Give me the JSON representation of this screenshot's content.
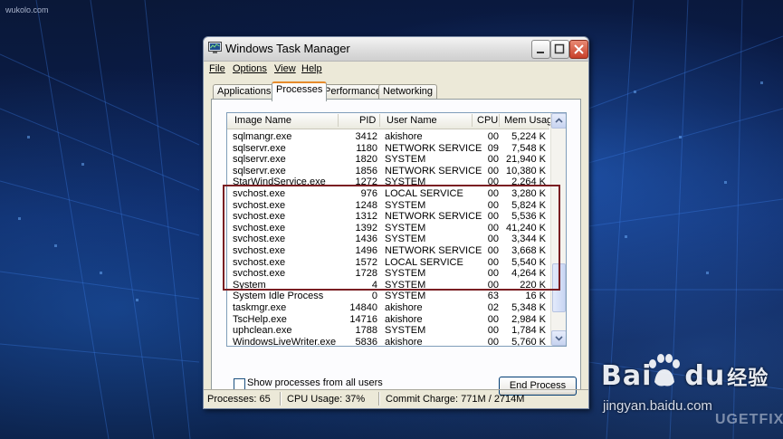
{
  "window": {
    "title": "Windows Task Manager",
    "controls": {
      "minimize": "_",
      "maximize": "□",
      "close": "×"
    }
  },
  "menu": [
    "File",
    "Options",
    "View",
    "Help"
  ],
  "tabs": [
    {
      "label": "Applications"
    },
    {
      "label": "Processes",
      "active": true
    },
    {
      "label": "Performance"
    },
    {
      "label": "Networking"
    }
  ],
  "columns": [
    "Image Name",
    "PID",
    "User Name",
    "CPU",
    "Mem Usage"
  ],
  "rows": [
    [
      "sqlmangr.exe",
      "3412",
      "akishore",
      "00",
      "5,224 K"
    ],
    [
      "sqlservr.exe",
      "1180",
      "NETWORK SERVICE",
      "09",
      "7,548 K"
    ],
    [
      "sqlservr.exe",
      "1820",
      "SYSTEM",
      "00",
      "21,940 K"
    ],
    [
      "sqlservr.exe",
      "1856",
      "NETWORK SERVICE",
      "00",
      "10,380 K"
    ],
    [
      "StarWindService.exe",
      "1272",
      "SYSTEM",
      "00",
      "2,264 K"
    ],
    [
      "svchost.exe",
      "976",
      "LOCAL SERVICE",
      "00",
      "3,280 K"
    ],
    [
      "svchost.exe",
      "1248",
      "SYSTEM",
      "00",
      "5,824 K"
    ],
    [
      "svchost.exe",
      "1312",
      "NETWORK SERVICE",
      "00",
      "5,536 K"
    ],
    [
      "svchost.exe",
      "1392",
      "SYSTEM",
      "00",
      "41,240 K"
    ],
    [
      "svchost.exe",
      "1436",
      "SYSTEM",
      "00",
      "3,344 K"
    ],
    [
      "svchost.exe",
      "1496",
      "NETWORK SERVICE",
      "00",
      "3,668 K"
    ],
    [
      "svchost.exe",
      "1572",
      "LOCAL SERVICE",
      "00",
      "5,540 K"
    ],
    [
      "svchost.exe",
      "1728",
      "SYSTEM",
      "00",
      "4,264 K"
    ],
    [
      "System",
      "4",
      "SYSTEM",
      "00",
      "220 K"
    ],
    [
      "System Idle Process",
      "0",
      "SYSTEM",
      "63",
      "16 K"
    ],
    [
      "taskmgr.exe",
      "14840",
      "akishore",
      "02",
      "5,348 K"
    ],
    [
      "TscHelp.exe",
      "14716",
      "akishore",
      "00",
      "2,984 K"
    ],
    [
      "uphclean.exe",
      "1788",
      "SYSTEM",
      "00",
      "1,784 K"
    ],
    [
      "WindowsLiveWriter.exe",
      "5836",
      "akishore",
      "00",
      "5,760 K"
    ]
  ],
  "checkbox_label": "Show processes from all users",
  "end_process_label": "End Process",
  "status": {
    "processes": "Processes: 65",
    "cpu": "CPU Usage: 37%",
    "commit": "Commit Charge: 771M / 2714M"
  },
  "desktop": {
    "corner_text": "wukolo.com",
    "watermark_logo_a": "Bai",
    "watermark_logo_b": "du",
    "watermark_logo_c": "经验",
    "watermark_url": "jingyan.baidu.com",
    "watermark_brand": "UGETFIX"
  },
  "colors": {
    "highlight_box": "#7a1e22",
    "tab_accent": "#e68b2c"
  }
}
